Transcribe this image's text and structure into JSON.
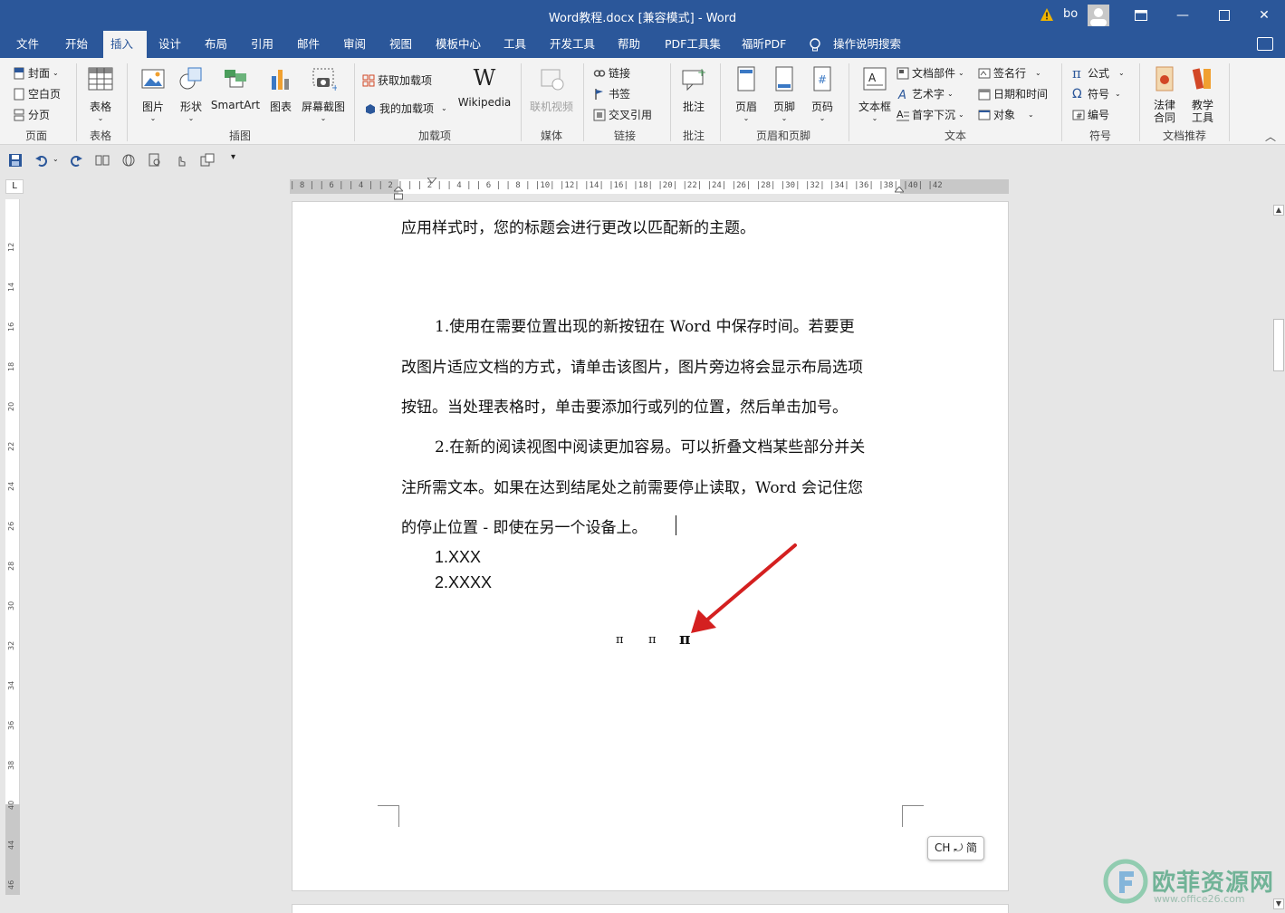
{
  "window": {
    "title": "Word教程.docx [兼容模式]  -  Word",
    "user": "bo",
    "controls": [
      "restore-ribbon",
      "minimize",
      "maximize",
      "close"
    ]
  },
  "tabs": [
    "文件",
    "开始",
    "插入",
    "设计",
    "布局",
    "引用",
    "邮件",
    "审阅",
    "视图",
    "模板中心",
    "工具",
    "开发工具",
    "帮助",
    "PDF工具集",
    "福昕PDF",
    "操作说明搜索"
  ],
  "active_tab": "插入",
  "ribbon": {
    "page": {
      "label": "页面",
      "items": [
        "封面",
        "空白页",
        "分页"
      ]
    },
    "table": {
      "label": "表格",
      "button": "表格"
    },
    "illustrations": {
      "label": "插图",
      "items": [
        "图片",
        "形状",
        "SmartArt",
        "图表",
        "屏幕截图"
      ]
    },
    "addins": {
      "label": "加载项",
      "get": "获取加载项",
      "mine": "我的加载项",
      "wiki": "Wikipedia"
    },
    "media": {
      "label": "媒体",
      "button": "联机视频"
    },
    "links": {
      "label": "链接",
      "items": [
        "链接",
        "书签",
        "交叉引用"
      ]
    },
    "comments": {
      "label": "批注",
      "button": "批注"
    },
    "header_footer": {
      "label": "页眉和页脚",
      "items": [
        "页眉",
        "页脚",
        "页码"
      ]
    },
    "text": {
      "label": "文本",
      "textbox": "文本框",
      "items": [
        "文档部件",
        "艺术字",
        "首字下沉",
        "签名行",
        "日期和时间",
        "对象"
      ]
    },
    "symbols": {
      "label": "符号",
      "items": [
        "公式",
        "符号",
        "编号"
      ]
    },
    "recommend": {
      "label": "文档推荐",
      "items": [
        "法律\n合同",
        "教学\n工具"
      ]
    }
  },
  "ruler": {
    "ticks": "| 8 |  | 6 |  | 4 |  | 2 |  |  | 2 |  | 4 |  | 6 |  | 8 |  |10|  |12|  |14|  |16|  |18|  |20|  |22|  |24|  |26|  |28|  |30|  |32|  |34|  |36|  |38|  |40|  |42",
    "vertical": [
      "12",
      "14",
      "16",
      "18",
      "20",
      "22",
      "24",
      "26",
      "28",
      "30",
      "32",
      "34",
      "36",
      "38",
      "40",
      "44",
      "46"
    ]
  },
  "document": {
    "line1": "应用样式时，您的标题会进行更改以匹配新的主题。",
    "para1": [
      "1.使用在需要位置出现的新按钮在 Word 中保存时间。若要更",
      "改图片适应文档的方式，请单击该图片，图片旁边将会显示布局选项",
      "按钮。当处理表格时，单击要添加行或列的位置，然后单击加号。"
    ],
    "para2": [
      "2.在新的阅读视图中阅读更加容易。可以折叠文档某些部分并关",
      "注所需文本。如果在达到结尾处之前需要停止读取，Word 会记住您",
      "的停止位置 - 即使在另一个设备上。"
    ],
    "list": [
      "1.XXX",
      "2.XXXX"
    ],
    "pi_symbols": [
      "π",
      "π",
      "π"
    ]
  },
  "ime": "CH ⤾ 简",
  "watermark": {
    "title": "欧菲资源网",
    "url": "www.office26.com"
  },
  "colors": {
    "word_blue": "#2b579a",
    "arrow_red": "#d42020"
  }
}
